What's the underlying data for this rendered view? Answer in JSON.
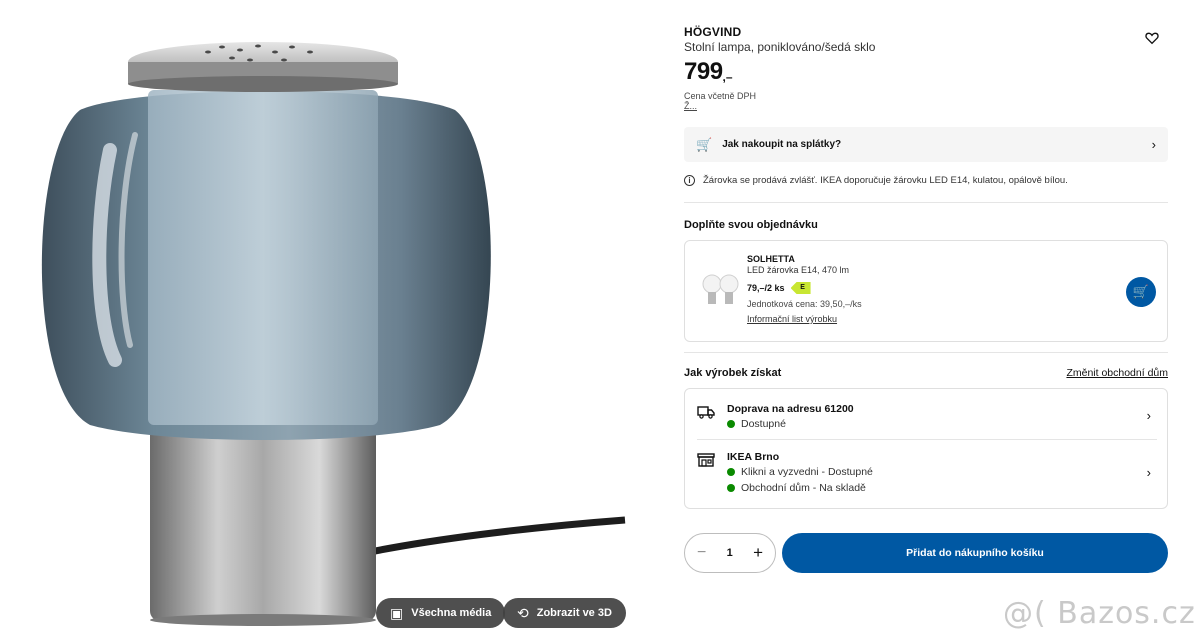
{
  "media": {
    "all_media_label": "Všechna média",
    "view_3d_label": "Zobrazit ve 3D"
  },
  "product": {
    "name": "HÖGVIND",
    "description": "Stolní lampa, poniklováno/šedá sklo",
    "price_int": "799",
    "price_dec": ",–",
    "vat_label": "Cena včetně DPH",
    "vat_note": "Ž..."
  },
  "installment": {
    "label": "Jak nakoupit na splátky?"
  },
  "bulb_info": "Žárovka se prodává zvlášť. IKEA doporučuje žárovku LED E14, kulatou, opálově bílou.",
  "complete_order": {
    "title": "Doplňte svou objednávku",
    "addon": {
      "name": "SOLHETTA",
      "description": "LED žárovka E14, 470 lm",
      "price": "79,–/2 ks",
      "energy_class": "E",
      "unit_price": "Jednotková cena: 39,50,–/ks",
      "info_link": "Informační list výrobku"
    }
  },
  "availability": {
    "title": "Jak výrobek získat",
    "change_store": "Změnit obchodní dům",
    "delivery": {
      "title": "Doprava na adresu 61200",
      "status": "Dostupné"
    },
    "store": {
      "title": "IKEA Brno",
      "status_1": "Klikni a vyzvedni - Dostupné",
      "status_2": "Obchodní dům - Na skladě"
    },
    "status_color": "#0a8a00"
  },
  "purchase": {
    "quantity": "1",
    "minus": "−",
    "plus": "+",
    "add_to_cart": "Přidat do nákupního košíku"
  },
  "colors": {
    "brand_blue": "#0058a3",
    "energy_green": "#c8e632"
  },
  "watermark": "@( Bazos.cz"
}
